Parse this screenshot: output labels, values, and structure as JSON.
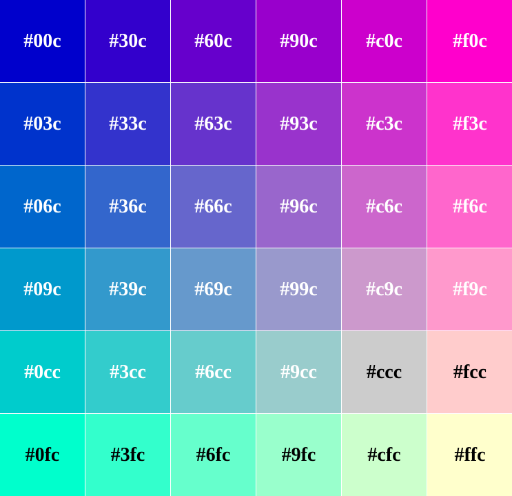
{
  "rows": [
    [
      {
        "label": "#00c",
        "color": "#0000cc",
        "text_color": "#ffffff"
      },
      {
        "label": "#30c",
        "color": "#3300cc",
        "text_color": "#ffffff"
      },
      {
        "label": "#60c",
        "color": "#6600cc",
        "text_color": "#ffffff"
      },
      {
        "label": "#90c",
        "color": "#9900cc",
        "text_color": "#ffffff"
      },
      {
        "label": "#c0c",
        "color": "#cc00cc",
        "text_color": "#ffffff"
      },
      {
        "label": "#f0c",
        "color": "#ff00cc",
        "text_color": "#ffffff"
      }
    ],
    [
      {
        "label": "#03c",
        "color": "#0033cc",
        "text_color": "#ffffff"
      },
      {
        "label": "#33c",
        "color": "#3333cc",
        "text_color": "#ffffff"
      },
      {
        "label": "#63c",
        "color": "#6633cc",
        "text_color": "#ffffff"
      },
      {
        "label": "#93c",
        "color": "#9933cc",
        "text_color": "#ffffff"
      },
      {
        "label": "#c3c",
        "color": "#cc33cc",
        "text_color": "#ffffff"
      },
      {
        "label": "#f3c",
        "color": "#ff33cc",
        "text_color": "#ffffff"
      }
    ],
    [
      {
        "label": "#06c",
        "color": "#0066cc",
        "text_color": "#ffffff"
      },
      {
        "label": "#36c",
        "color": "#3366cc",
        "text_color": "#ffffff"
      },
      {
        "label": "#66c",
        "color": "#6666cc",
        "text_color": "#ffffff"
      },
      {
        "label": "#96c",
        "color": "#9966cc",
        "text_color": "#ffffff"
      },
      {
        "label": "#c6c",
        "color": "#cc66cc",
        "text_color": "#ffffff"
      },
      {
        "label": "#f6c",
        "color": "#ff66cc",
        "text_color": "#ffffff"
      }
    ],
    [
      {
        "label": "#09c",
        "color": "#0099cc",
        "text_color": "#ffffff"
      },
      {
        "label": "#39c",
        "color": "#3399cc",
        "text_color": "#ffffff"
      },
      {
        "label": "#69c",
        "color": "#6699cc",
        "text_color": "#ffffff"
      },
      {
        "label": "#99c",
        "color": "#9999cc",
        "text_color": "#ffffff"
      },
      {
        "label": "#c9c",
        "color": "#cc99cc",
        "text_color": "#ffffff"
      },
      {
        "label": "#f9c",
        "color": "#ff99cc",
        "text_color": "#ffffff"
      }
    ],
    [
      {
        "label": "#0cc",
        "color": "#00cccc",
        "text_color": "#ffffff"
      },
      {
        "label": "#3cc",
        "color": "#33cccc",
        "text_color": "#ffffff"
      },
      {
        "label": "#6cc",
        "color": "#66cccc",
        "text_color": "#ffffff"
      },
      {
        "label": "#9cc",
        "color": "#99cccc",
        "text_color": "#ffffff"
      },
      {
        "label": "#ccc",
        "color": "#cccccc",
        "text_color": "#000000"
      },
      {
        "label": "#fcc",
        "color": "#ffcccc",
        "text_color": "#000000"
      }
    ],
    [
      {
        "label": "#0fc",
        "color": "#00ffcc",
        "text_color": "#000000"
      },
      {
        "label": "#3fc",
        "color": "#33ffcc",
        "text_color": "#000000"
      },
      {
        "label": "#6fc",
        "color": "#66ffcc",
        "text_color": "#000000"
      },
      {
        "label": "#9fc",
        "color": "#99ffcc",
        "text_color": "#000000"
      },
      {
        "label": "#cfc",
        "color": "#ccffcc",
        "text_color": "#000000"
      },
      {
        "label": "#ffc",
        "color": "#ffffcc",
        "text_color": "#000000"
      }
    ]
  ]
}
